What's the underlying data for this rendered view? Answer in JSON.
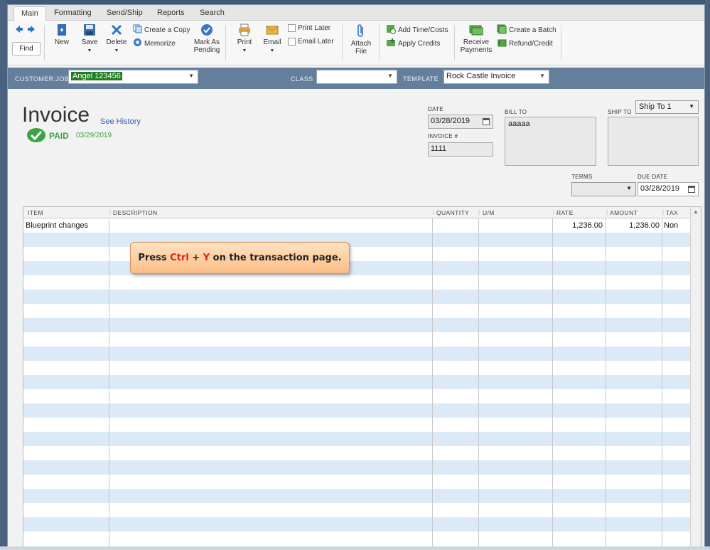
{
  "tabs": [
    "Main",
    "Formatting",
    "Send/Ship",
    "Reports",
    "Search"
  ],
  "toolbar": {
    "find": "Find",
    "new": "New",
    "save": "Save",
    "delete": "Delete",
    "create_copy": "Create a Copy",
    "memorize": "Memorize",
    "mark_as_pending": [
      "Mark As",
      "Pending"
    ],
    "print": "Print",
    "email": "Email",
    "print_later": "Print Later",
    "email_later": "Email Later",
    "attach_file": [
      "Attach",
      "File"
    ],
    "add_time_costs": "Add Time/Costs",
    "apply_credits": "Apply Credits",
    "receive_payments": [
      "Receive",
      "Payments"
    ],
    "create_batch": "Create a Batch",
    "refund_credit": "Refund/Credit"
  },
  "customer_bar": {
    "customer_job_label": "CUSTOMER:JOB",
    "customer_job_value": "Angel 123456",
    "class_label": "CLASS",
    "class_value": "",
    "template_label": "TEMPLATE",
    "template_value": "Rock Castle Invoice"
  },
  "invoice": {
    "title": "Invoice",
    "see_history": "See History",
    "status": "PAID",
    "status_date": "03/29/2019",
    "date_label": "DATE",
    "date": "03/28/2019",
    "invoice_no_label": "INVOICE #",
    "invoice_no": "1111",
    "bill_to_label": "BILL TO",
    "bill_to": "aaaaa",
    "ship_to_label": "SHIP TO",
    "ship_to_select": "Ship To 1",
    "terms_label": "TERMS",
    "terms": "",
    "due_date_label": "DUE DATE",
    "due_date": "03/28/2019"
  },
  "table": {
    "columns": [
      "ITEM",
      "DESCRIPTION",
      "QUANTITY",
      "U/M",
      "RATE",
      "AMOUNT",
      "TAX"
    ],
    "rows": [
      {
        "item": "Blueprint changes",
        "description": "",
        "quantity": "",
        "um": "",
        "rate": "1,236.00",
        "amount": "1,236.00",
        "tax": "Non"
      }
    ]
  },
  "callout": {
    "prefix": "Press ",
    "key1": "Ctrl",
    "plus": " + ",
    "key2": "Y",
    "suffix": " on the transaction page."
  },
  "colors": {
    "paid_green": "#3da244",
    "header_bar": "#647f9c",
    "row_alt": "#dce9f7",
    "callout_red": "#e0201a"
  }
}
